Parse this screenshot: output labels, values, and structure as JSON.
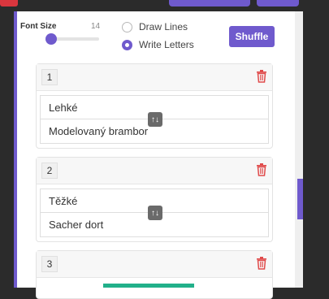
{
  "controls": {
    "font_size_label": "Font Size",
    "font_size_value": "14",
    "radio_options": [
      {
        "label": "Draw Lines",
        "checked": false
      },
      {
        "label": "Write Letters",
        "checked": true
      }
    ],
    "shuffle_label": "Shuffle"
  },
  "pairs": [
    {
      "number": "1",
      "left": "Lehké",
      "right": "Modelovaný brambor"
    },
    {
      "number": "2",
      "left": "Těžké",
      "right": "Sacher dort"
    },
    {
      "number": "3",
      "left": "",
      "right": ""
    }
  ],
  "colors": {
    "accent": "#6f5acd",
    "delete": "#e04b4b",
    "swap": "#6a6a6a"
  },
  "icons": {
    "delete": "trash-icon",
    "swap": "swap-arrows-icon"
  }
}
